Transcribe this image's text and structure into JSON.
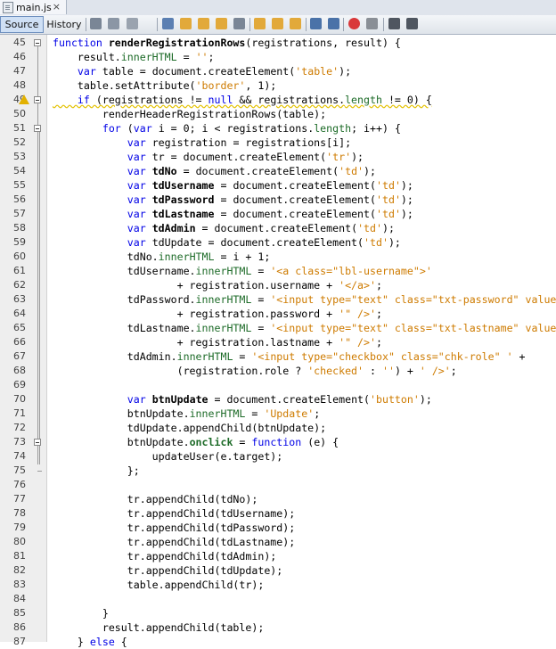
{
  "file_tab": {
    "name": "main.js",
    "close": "×"
  },
  "toolbar": {
    "source": "Source",
    "history": "History"
  },
  "code": {
    "line_numbers": [
      "45",
      "46",
      "47",
      "48",
      "49",
      "50",
      "51",
      "52",
      "53",
      "54",
      "55",
      "56",
      "57",
      "58",
      "59",
      "60",
      "61",
      "62",
      "63",
      "64",
      "65",
      "66",
      "67",
      "68",
      "69",
      "70",
      "71",
      "72",
      "73",
      "74",
      "75",
      "76",
      "77",
      "78",
      "79",
      "80",
      "81",
      "82",
      "83",
      "84",
      "85",
      "86",
      "87"
    ],
    "lines": [
      "function renderRegistrationRows(registrations, result) {",
      "    result.innerHTML = '';",
      "    var table = document.createElement('table');",
      "    table.setAttribute('border', 1);",
      "    if (registrations != null && registrations.length != 0) {",
      "        renderHeaderRegistrationRows(table);",
      "        for (var i = 0; i < registrations.length; i++) {",
      "            var registration = registrations[i];",
      "            var tr = document.createElement('tr');",
      "            var tdNo = document.createElement('td');",
      "            var tdUsername = document.createElement('td');",
      "            var tdPassword = document.createElement('td');",
      "            var tdLastname = document.createElement('td');",
      "            var tdAdmin = document.createElement('td');",
      "            var tdUpdate = document.createElement('td');",
      "            tdNo.innerHTML = i + 1;",
      "            tdUsername.innerHTML = '<a class=\"lbl-username\">'",
      "                    + registration.username + '</a>';",
      "            tdPassword.innerHTML = '<input type=\"text\" class=\"txt-password\" value=\"'",
      "                    + registration.password + '\" />';",
      "            tdLastname.innerHTML = '<input type=\"text\" class=\"txt-lastname\" value=\"'",
      "                    + registration.lastname + '\" />';",
      "            tdAdmin.innerHTML = '<input type=\"checkbox\" class=\"chk-role\" ' +",
      "                    (registration.role ? 'checked' : '') + ' />';",
      "",
      "            var btnUpdate = document.createElement('button');",
      "            btnUpdate.innerHTML = 'Update';",
      "            tdUpdate.appendChild(btnUpdate);",
      "            btnUpdate.onclick = function (e) {",
      "                updateUser(e.target);",
      "            };",
      "",
      "            tr.appendChild(tdNo);",
      "            tr.appendChild(tdUsername);",
      "            tr.appendChild(tdPassword);",
      "            tr.appendChild(tdLastname);",
      "            tr.appendChild(tdAdmin);",
      "            tr.appendChild(tdUpdate);",
      "            table.appendChild(tr);",
      "",
      "        }",
      "        result.appendChild(table);",
      "    } else {"
    ]
  },
  "colors": {
    "keyword": "#0000e6",
    "string": "#ce7b00",
    "property": "#1d6b28",
    "warning": "#e2b100"
  },
  "icons": [
    "file-js-icon",
    "close-icon",
    "back-icon",
    "forward-icon",
    "search-icon",
    "find-prev-icon",
    "find-next-icon",
    "toggle-highlight-icon",
    "shift-left-icon",
    "shift-right-icon",
    "comment-icon",
    "uncomment-icon",
    "record-macro-icon",
    "stop-macro-icon",
    "diff-icon",
    "warning-icon"
  ]
}
